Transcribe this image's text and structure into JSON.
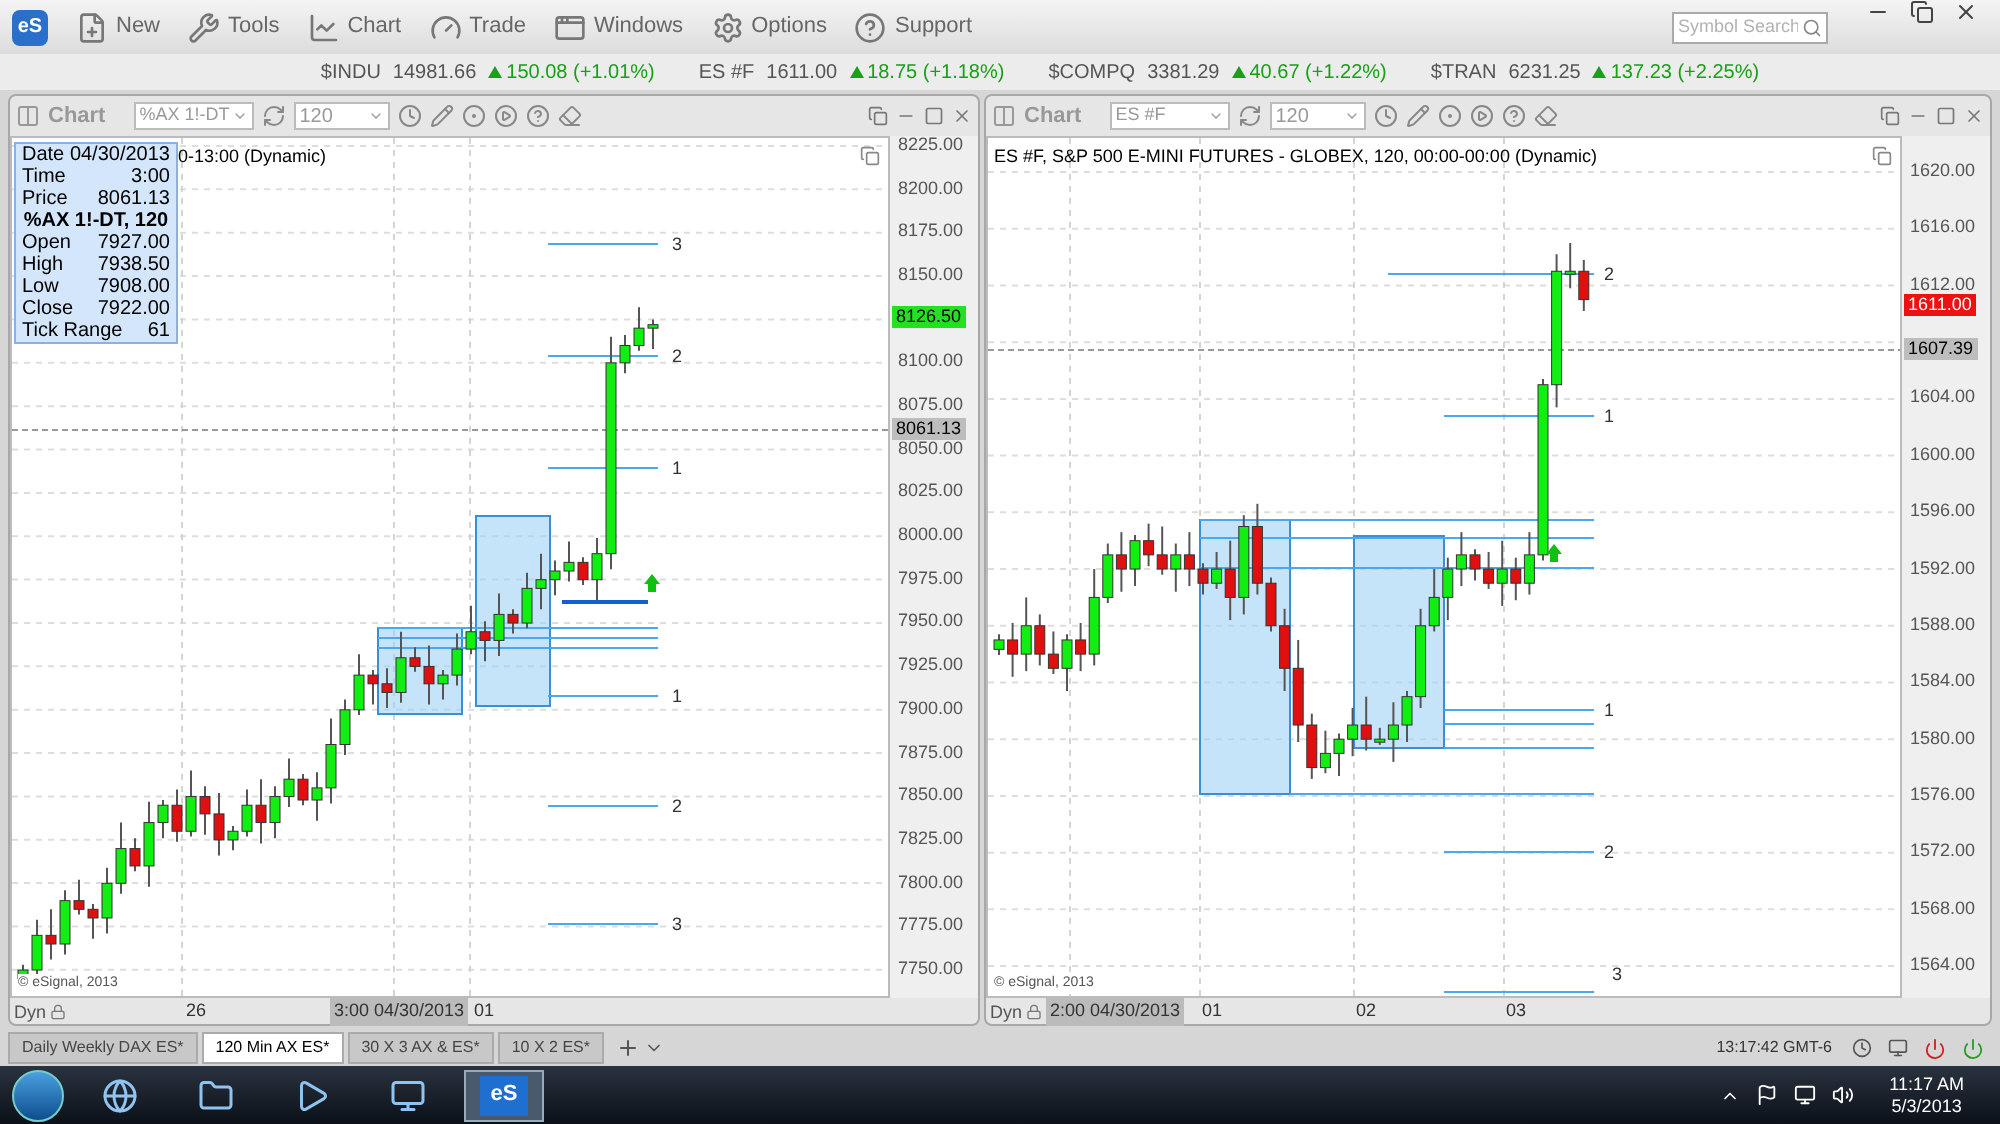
{
  "toolbar": {
    "logo": "eS",
    "items": [
      {
        "label": "New"
      },
      {
        "label": "Tools"
      },
      {
        "label": "Chart"
      },
      {
        "label": "Trade"
      },
      {
        "label": "Windows"
      },
      {
        "label": "Options"
      },
      {
        "label": "Support"
      }
    ],
    "search": {
      "placeholder": "Symbol Search"
    }
  },
  "ticker": [
    {
      "symbol": "$INDU",
      "price": "14981.66",
      "change": "150.08 (+1.01%)"
    },
    {
      "symbol": "ES #F",
      "price": "1611.00",
      "change": "18.75 (+1.18%)"
    },
    {
      "symbol": "$COMPQ",
      "price": "3381.29",
      "change": "40.67 (+1.22%)"
    },
    {
      "symbol": "$TRAN",
      "price": "6231.25",
      "change": "137.23 (+2.25%)"
    }
  ],
  "charts": [
    {
      "label": "Chart",
      "symbol": "%AX 1!-DT",
      "interval": "120",
      "title": "0-13:00 (Dynamic)",
      "data_window": {
        "top": [
          {
            "name": "Date",
            "value": "04/30/2013"
          },
          {
            "name": "Time",
            "value": "3:00"
          },
          {
            "name": "Price",
            "value": "8061.13"
          }
        ],
        "heading": "%AX 1!-DT, 120",
        "rows": [
          {
            "name": "Open",
            "value": "7927.00"
          },
          {
            "name": "High",
            "value": "7938.50"
          },
          {
            "name": "Low",
            "value": "7908.00"
          },
          {
            "name": "Close",
            "value": "7922.00"
          },
          {
            "name": "Tick Range",
            "value": "61"
          }
        ]
      },
      "y_axis": [
        "8225.00",
        "8200.00",
        "8175.00",
        "8150.00",
        "8100.00",
        "8075.00",
        "8050.00",
        "8025.00",
        "8000.00",
        "7975.00",
        "7950.00",
        "7925.00",
        "7900.00",
        "7875.00",
        "7850.00",
        "7825.00",
        "7800.00",
        "7775.00",
        "7750.00"
      ],
      "price_tags": [
        {
          "text": "8126.50",
          "kind": "last_up"
        },
        {
          "text": "8061.13",
          "kind": "cursor"
        }
      ],
      "level_labels": [
        "3",
        "2",
        "1",
        "1",
        "2",
        "3"
      ],
      "x_axis": {
        "mode": "Dyn",
        "cursor": "3:00 04/30/2013",
        "labels": [
          "26",
          "01"
        ]
      },
      "copyright": "© eSignal, 2013"
    },
    {
      "label": "Chart",
      "symbol": "ES #F",
      "interval": "120",
      "title": "ES #F, S&P 500 E-MINI FUTURES - GLOBEX, 120, 00:00-00:00 (Dynamic)",
      "y_axis": [
        "1620.00",
        "1616.00",
        "1612.00",
        "1604.00",
        "1600.00",
        "1596.00",
        "1592.00",
        "1588.00",
        "1584.00",
        "1580.00",
        "1576.00",
        "1572.00",
        "1568.00",
        "1564.00"
      ],
      "price_tags": [
        {
          "text": "1611.00",
          "kind": "last_down"
        },
        {
          "text": "1607.39",
          "kind": "cursor"
        }
      ],
      "level_labels": [
        "2",
        "1",
        "1",
        "2",
        "3"
      ],
      "x_axis": {
        "mode": "Dyn",
        "cursor": "2:00 04/30/2013",
        "labels": [
          "01",
          "02",
          "03"
        ]
      },
      "copyright": "© eSignal, 2013"
    }
  ],
  "tabs": [
    {
      "label": "Daily Weekly DAX ES*",
      "selected": false
    },
    {
      "label": "120 Min AX ES*",
      "selected": true
    },
    {
      "label": "30 X 3 AX & ES*",
      "selected": false
    },
    {
      "label": "10 X 2 ES*",
      "selected": false
    }
  ],
  "status": {
    "clock": "13:17:42 GMT-6"
  },
  "taskbar": {
    "apps": [
      {
        "selected": false
      },
      {
        "selected": false
      },
      {
        "selected": false
      },
      {
        "selected": false
      },
      {
        "label": "eS",
        "selected": true
      }
    ],
    "time": "11:17 AM",
    "date": "5/3/2013"
  }
}
